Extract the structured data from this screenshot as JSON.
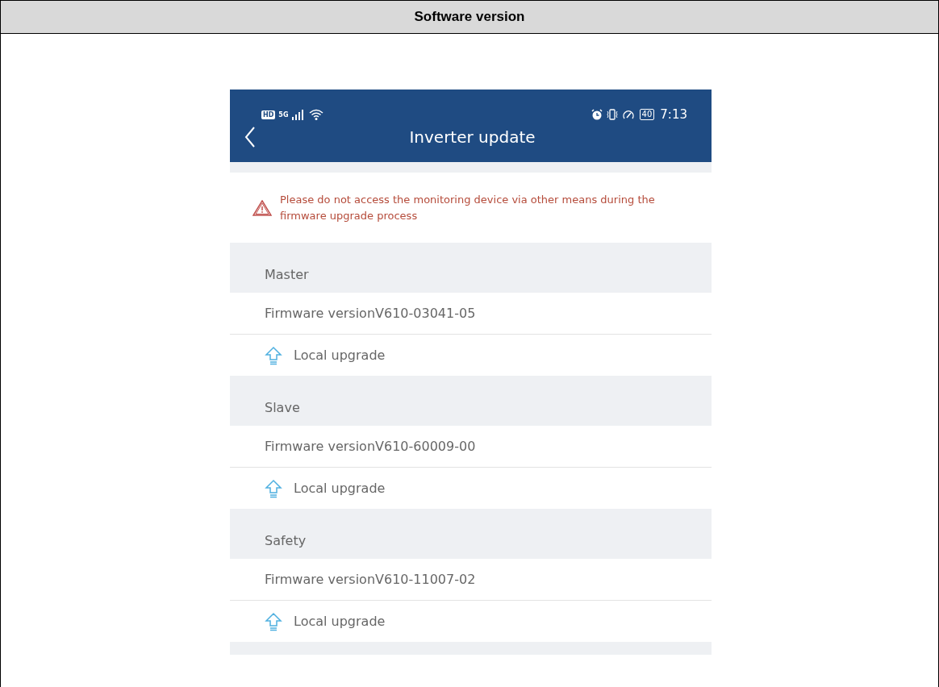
{
  "table": {
    "heading": "Software version"
  },
  "phone": {
    "status_bar": {
      "hd": "HD",
      "network": "5G",
      "battery": "40",
      "time": "7:13"
    },
    "title": "Inverter update",
    "warning": "Please do not access the monitoring device via other means during the firmware upgrade process",
    "sections": [
      {
        "name": "Master",
        "firmware": "Firmware versionV610-03041-05",
        "action": "Local upgrade"
      },
      {
        "name": "Slave",
        "firmware": "Firmware versionV610-60009-00",
        "action": "Local upgrade"
      },
      {
        "name": "Safety",
        "firmware": "Firmware versionV610-11007-02",
        "action": "Local upgrade"
      }
    ]
  }
}
